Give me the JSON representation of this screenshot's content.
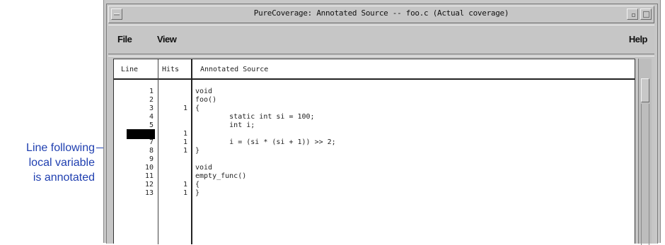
{
  "callout": {
    "lines": [
      "Line following",
      "local variable",
      "is annotated"
    ]
  },
  "window": {
    "title": "PureCoverage: Annotated Source -- foo.c (Actual coverage)"
  },
  "menu": {
    "file": "File",
    "view": "View",
    "help": "Help"
  },
  "table": {
    "headers": {
      "line": "Line",
      "hits": "Hits",
      "source": "Annotated Source"
    },
    "rows": [
      {
        "line": "1",
        "hits": "",
        "source": "void"
      },
      {
        "line": "2",
        "hits": "",
        "source": "foo()"
      },
      {
        "line": "3",
        "hits": "1",
        "source": "{"
      },
      {
        "line": "4",
        "hits": "",
        "source": "        static int si = 100;"
      },
      {
        "line": "5",
        "hits": "",
        "source": "        int i;"
      },
      {
        "line": "6",
        "hits": "1",
        "source": "",
        "highlighted": true
      },
      {
        "line": "7",
        "hits": "1",
        "source": "        i = (si * (si + 1)) >> 2;"
      },
      {
        "line": "8",
        "hits": "1",
        "source": "}"
      },
      {
        "line": "9",
        "hits": "",
        "source": ""
      },
      {
        "line": "10",
        "hits": "",
        "source": "void"
      },
      {
        "line": "11",
        "hits": "",
        "source": "empty_func()"
      },
      {
        "line": "12",
        "hits": "1",
        "source": "{"
      },
      {
        "line": "13",
        "hits": "1",
        "source": "}"
      }
    ]
  },
  "colors": {
    "callout": "#1f3fb0",
    "window_bg": "#c6c6c6",
    "highlight": "#000000"
  }
}
